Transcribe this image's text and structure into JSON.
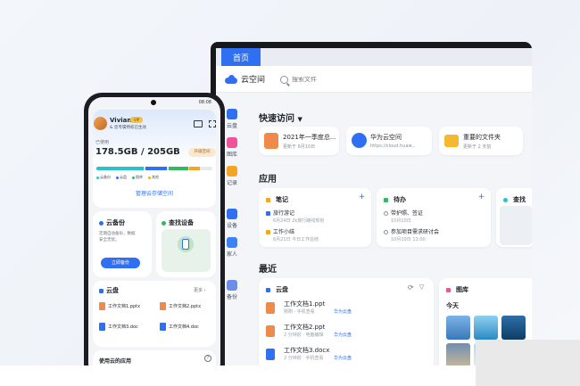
{
  "laptop": {
    "tab_home": "首页",
    "brand": "云空间",
    "search_placeholder": "搜索文件",
    "sidebar": [
      {
        "label": "云盘",
        "color": "#2f6ff2"
      },
      {
        "label": "图库",
        "color": "#f0529c"
      },
      {
        "label": "记录",
        "color": "#f5a524"
      },
      {
        "label": "设备",
        "color": "#2f6ff2"
      },
      {
        "label": "家人",
        "color": "#3b82f6"
      },
      {
        "label": "备份",
        "color": "#6b8fe8"
      }
    ],
    "quick_access": {
      "title": "快速访问",
      "items": [
        {
          "title": "2021年一季度总...",
          "sub": "更新于 6月10日",
          "icon": "ppt-file-icon",
          "color": "#f08a4b"
        },
        {
          "title": "华为云空间",
          "sub": "https://cloud.huaw...",
          "icon": "globe-icon",
          "color": "#2f6ff2"
        },
        {
          "title": "重要的文件夹",
          "sub": "更新于 2 天前",
          "icon": "folder-icon",
          "color": "#f5b82e"
        }
      ]
    },
    "apps": {
      "title": "应用",
      "notes": {
        "title": "笔记",
        "items": [
          {
            "label": "旅行游记",
            "sub": "6月24日  2k旅行路线规划",
            "color": "#2f6ff2"
          },
          {
            "label": "工作小结",
            "sub": "6月21日  今日工作总结",
            "color": "#f5a524"
          }
        ]
      },
      "todo": {
        "title": "待办",
        "items": [
          {
            "label": "带护照、签证",
            "sub": "10月10日"
          },
          {
            "label": "参加项目需求研讨会",
            "sub": "10月10日 13:00"
          }
        ]
      },
      "third": {
        "title": "查找"
      }
    },
    "recent": {
      "title": "最近",
      "cloud_disk": {
        "title": "云盘",
        "files": [
          {
            "name": "工作文档1.ppt",
            "sub": "刚刚 · 手机查看",
            "source": "华为云盘",
            "color": "#f08a4b"
          },
          {
            "name": "工作文档2.ppt",
            "sub": "2 分钟前 · 电脑编辑",
            "source": "华为云盘",
            "color": "#f08a4b"
          },
          {
            "name": "工作文档3.docx",
            "sub": "2 分钟前 · 手机查看",
            "source": "华为云盘",
            "color": "#2f6ff2"
          }
        ]
      },
      "gallery": {
        "title": "图库",
        "today": "今天"
      }
    }
  },
  "phone": {
    "status_time": "08:08",
    "user_name": "Vivian",
    "vip_badge": "VIP",
    "user_sub": "& 您专属特权已生效",
    "used_label": "已使用",
    "storage": "178.5GB / 205GB",
    "upgrade": "升级空间",
    "storage_usage": [
      {
        "name": "云备份",
        "fraction": 0.42,
        "color": "#2cc3c8"
      },
      {
        "name": "云盘",
        "fraction": 0.2,
        "color": "#2f6ff2"
      },
      {
        "name": "图库",
        "fraction": 0.18,
        "color": "#33b863"
      },
      {
        "name": "其他",
        "fraction": 0.1,
        "color": "#f5a524"
      }
    ],
    "manage": "管理云存储空间",
    "backup": {
      "title": "云备份",
      "desc_line1": "定期自动备份，数据",
      "desc_line2": "安全无忧。",
      "button": "立即备份"
    },
    "find_device": {
      "title": "查找设备"
    },
    "cloud_disk": {
      "title": "云盘",
      "more": "更多 ›",
      "docs": [
        {
          "name": "工作文档1.pptx",
          "color": "#f08a4b"
        },
        {
          "name": "工作文档2.pptx",
          "color": "#f08a4b"
        },
        {
          "name": "工作文档3.doc",
          "color": "#2f6ff2"
        },
        {
          "name": "工作文档4.doc",
          "color": "#2f6ff2"
        }
      ]
    },
    "apps_title": "使用云的应用"
  }
}
